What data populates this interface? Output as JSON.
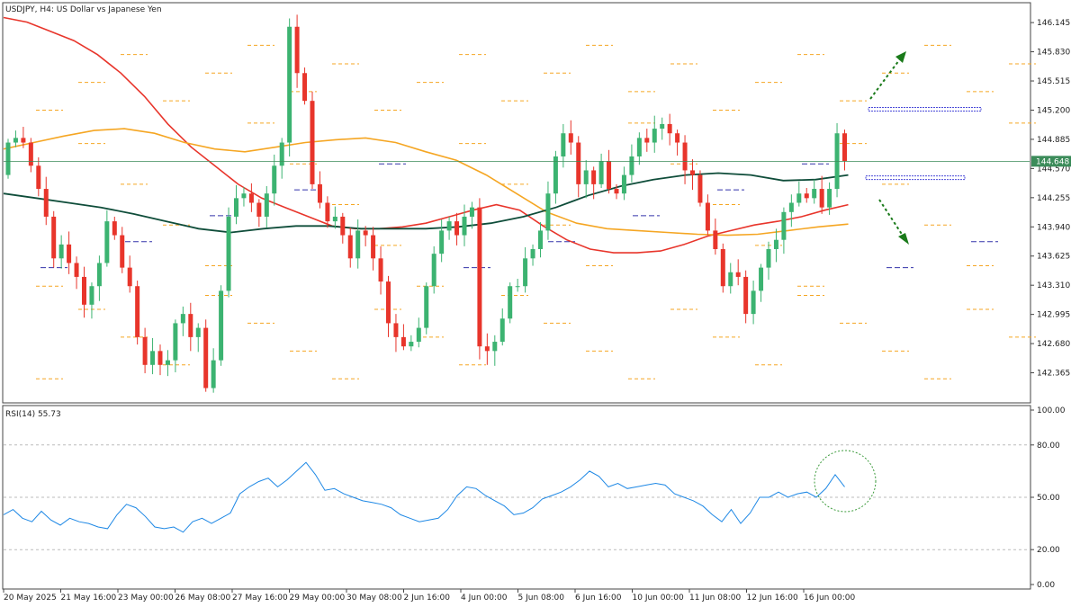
{
  "header": {
    "title": "USDJPY, H4:  US Dollar vs Japanese Yen",
    "rsi_label": "RSI(14) 55.73",
    "current_price": "144.648"
  },
  "colors": {
    "bull": "#3cb371",
    "bear": "#e8352b",
    "ma_fast": "#e8352b",
    "ma_mid": "#f5a623",
    "ma_slow": "#0f4d3a",
    "rsi_line": "#1e88e5",
    "arrow": "#1a7a1a",
    "level_box": "#4a4ad8",
    "price_line": "#3c8c5a"
  },
  "chart_data": [
    {
      "type": "candlestick",
      "title": "USDJPY, H4:  US Dollar vs Japanese Yen",
      "ylim": [
        142.05,
        146.35
      ],
      "y_ticks": [
        "146.145",
        "145.830",
        "145.515",
        "145.200",
        "144.885",
        "144.570",
        "144.255",
        "143.940",
        "143.625",
        "143.310",
        "142.995",
        "142.680",
        "142.365"
      ],
      "x_ticks": [
        "20 May 2025",
        "21 May 16:00",
        "23 May 00:00",
        "26 May 08:00",
        "27 May 16:00",
        "29 May 00:00",
        "30 May 08:00",
        "2 Jun 16:00",
        "4 Jun 00:00",
        "5 Jun 08:00",
        "6 Jun 16:00",
        "10 Jun 00:00",
        "11 Jun 08:00",
        "12 Jun 16:00",
        "16 Jun 00:00"
      ],
      "current_price": 144.648,
      "annotations": [
        "upper resistance box near 145.20",
        "lower support box near 144.45",
        "dotted arrow up",
        "dotted arrow down"
      ],
      "ohlc_open": [
        144.5,
        144.85,
        144.9,
        144.85,
        144.6,
        144.35,
        144.05,
        143.6,
        143.75,
        143.55,
        143.4,
        143.1,
        143.3,
        143.55,
        144.0,
        143.85,
        143.5,
        143.3,
        142.75,
        142.45,
        142.6,
        142.45,
        142.5,
        142.9,
        143.0,
        142.75,
        142.85,
        142.2,
        142.5,
        143.25,
        144.05,
        144.25,
        144.3,
        144.2,
        144.05,
        144.3,
        144.6,
        144.85,
        146.1,
        145.6,
        145.3,
        144.4,
        144.2,
        144.0,
        144.05,
        143.85,
        143.6,
        143.9,
        143.85,
        143.6,
        143.35,
        142.9,
        142.75,
        142.65,
        142.7,
        142.85,
        143.3,
        143.65,
        143.9,
        144.0,
        143.85,
        144.05,
        144.15,
        142.65,
        142.6,
        142.7,
        142.95,
        143.3,
        143.3,
        143.6,
        143.7,
        143.9,
        144.3,
        144.7,
        144.95,
        144.85,
        144.4,
        144.55,
        144.4,
        144.65,
        144.35,
        144.3,
        144.5,
        144.7,
        144.9,
        144.85,
        145.0,
        145.05,
        144.95,
        144.85,
        144.55,
        144.5,
        144.2,
        143.9,
        143.7,
        143.3,
        143.45,
        143.4,
        143.0,
        143.25,
        143.5,
        143.7,
        143.8,
        144.1,
        144.2,
        144.3,
        144.25,
        144.35,
        144.15,
        144.35,
        144.95
      ],
      "ohlc_close": [
        144.85,
        144.9,
        144.85,
        144.6,
        144.35,
        144.05,
        143.6,
        143.75,
        143.55,
        143.4,
        143.1,
        143.3,
        143.55,
        144.0,
        143.85,
        143.5,
        143.3,
        142.75,
        142.45,
        142.6,
        142.45,
        142.5,
        142.9,
        143.0,
        142.75,
        142.85,
        142.2,
        142.5,
        143.25,
        144.05,
        144.25,
        144.3,
        144.2,
        144.05,
        144.3,
        144.6,
        144.85,
        146.1,
        145.6,
        145.3,
        144.4,
        144.2,
        144.0,
        144.05,
        143.85,
        143.6,
        143.9,
        143.85,
        143.6,
        143.35,
        142.9,
        142.75,
        142.65,
        142.7,
        142.85,
        143.3,
        143.65,
        143.9,
        144.0,
        143.85,
        144.05,
        144.15,
        142.65,
        142.6,
        142.7,
        142.95,
        143.3,
        143.3,
        143.6,
        143.7,
        143.9,
        144.3,
        144.7,
        144.95,
        144.85,
        144.4,
        144.55,
        144.4,
        144.65,
        144.35,
        144.3,
        144.5,
        144.7,
        144.9,
        144.85,
        145.0,
        145.05,
        144.95,
        144.85,
        144.55,
        144.5,
        144.2,
        143.9,
        143.7,
        143.3,
        143.45,
        143.4,
        143.0,
        143.25,
        143.5,
        143.7,
        143.8,
        144.1,
        144.2,
        144.3,
        144.25,
        144.35,
        144.15,
        144.35,
        144.95,
        144.65
      ],
      "series": [
        {
          "name": "MA fast",
          "values": [
            146.2,
            146.15,
            146.05,
            145.95,
            145.8,
            145.6,
            145.35,
            145.05,
            144.8,
            144.6,
            144.4,
            144.25,
            144.15,
            144.05,
            143.95,
            143.92,
            143.92,
            143.94,
            143.98,
            144.05,
            144.12,
            144.18,
            144.12,
            143.95,
            143.8,
            143.7,
            143.66,
            143.66,
            143.68,
            143.75,
            143.84,
            143.9,
            143.96,
            144.0,
            144.05,
            144.12,
            144.18
          ]
        },
        {
          "name": "MA mid",
          "values": [
            144.78,
            144.85,
            144.92,
            144.98,
            145.0,
            144.95,
            144.85,
            144.78,
            144.75,
            144.8,
            144.85,
            144.88,
            144.9,
            144.85,
            144.75,
            144.66,
            144.5,
            144.3,
            144.1,
            143.98,
            143.92,
            143.9,
            143.88,
            143.86,
            143.85,
            143.86,
            143.9,
            143.94,
            143.97
          ]
        },
        {
          "name": "MA slow",
          "values": [
            144.3,
            144.25,
            144.2,
            144.15,
            144.08,
            144.0,
            143.92,
            143.88,
            143.92,
            143.95,
            143.95,
            143.92,
            143.92,
            143.92,
            143.94,
            143.98,
            144.05,
            144.15,
            144.28,
            144.38,
            144.45,
            144.5,
            144.52,
            144.5,
            144.44,
            144.45,
            144.5
          ]
        }
      ]
    },
    {
      "type": "line",
      "title": "RSI(14) 55.73",
      "ylim": [
        0,
        100
      ],
      "y_ticks": [
        "100.00",
        "80.00",
        "50.00",
        "20.00",
        "0.00"
      ],
      "series": [
        {
          "name": "RSI(14)",
          "values": [
            40,
            43,
            38,
            36,
            42,
            37,
            34,
            38,
            36,
            35,
            33,
            32,
            40,
            46,
            44,
            39,
            33,
            32,
            33,
            30,
            36,
            38,
            35,
            38,
            41,
            52,
            56,
            59,
            61,
            56,
            60,
            65,
            70,
            63,
            54,
            55,
            52,
            50,
            48,
            47,
            46,
            44,
            40,
            38,
            36,
            37,
            38,
            43,
            51,
            56,
            55,
            51,
            48,
            45,
            40,
            41,
            44,
            49,
            51,
            53,
            56,
            60,
            65,
            62,
            56,
            58,
            55,
            56,
            57,
            58,
            57,
            52,
            50,
            48,
            45,
            40,
            36,
            43,
            35,
            41,
            50,
            50,
            53,
            50,
            52,
            53,
            50,
            55,
            63,
            56
          ]
        }
      ]
    }
  ]
}
